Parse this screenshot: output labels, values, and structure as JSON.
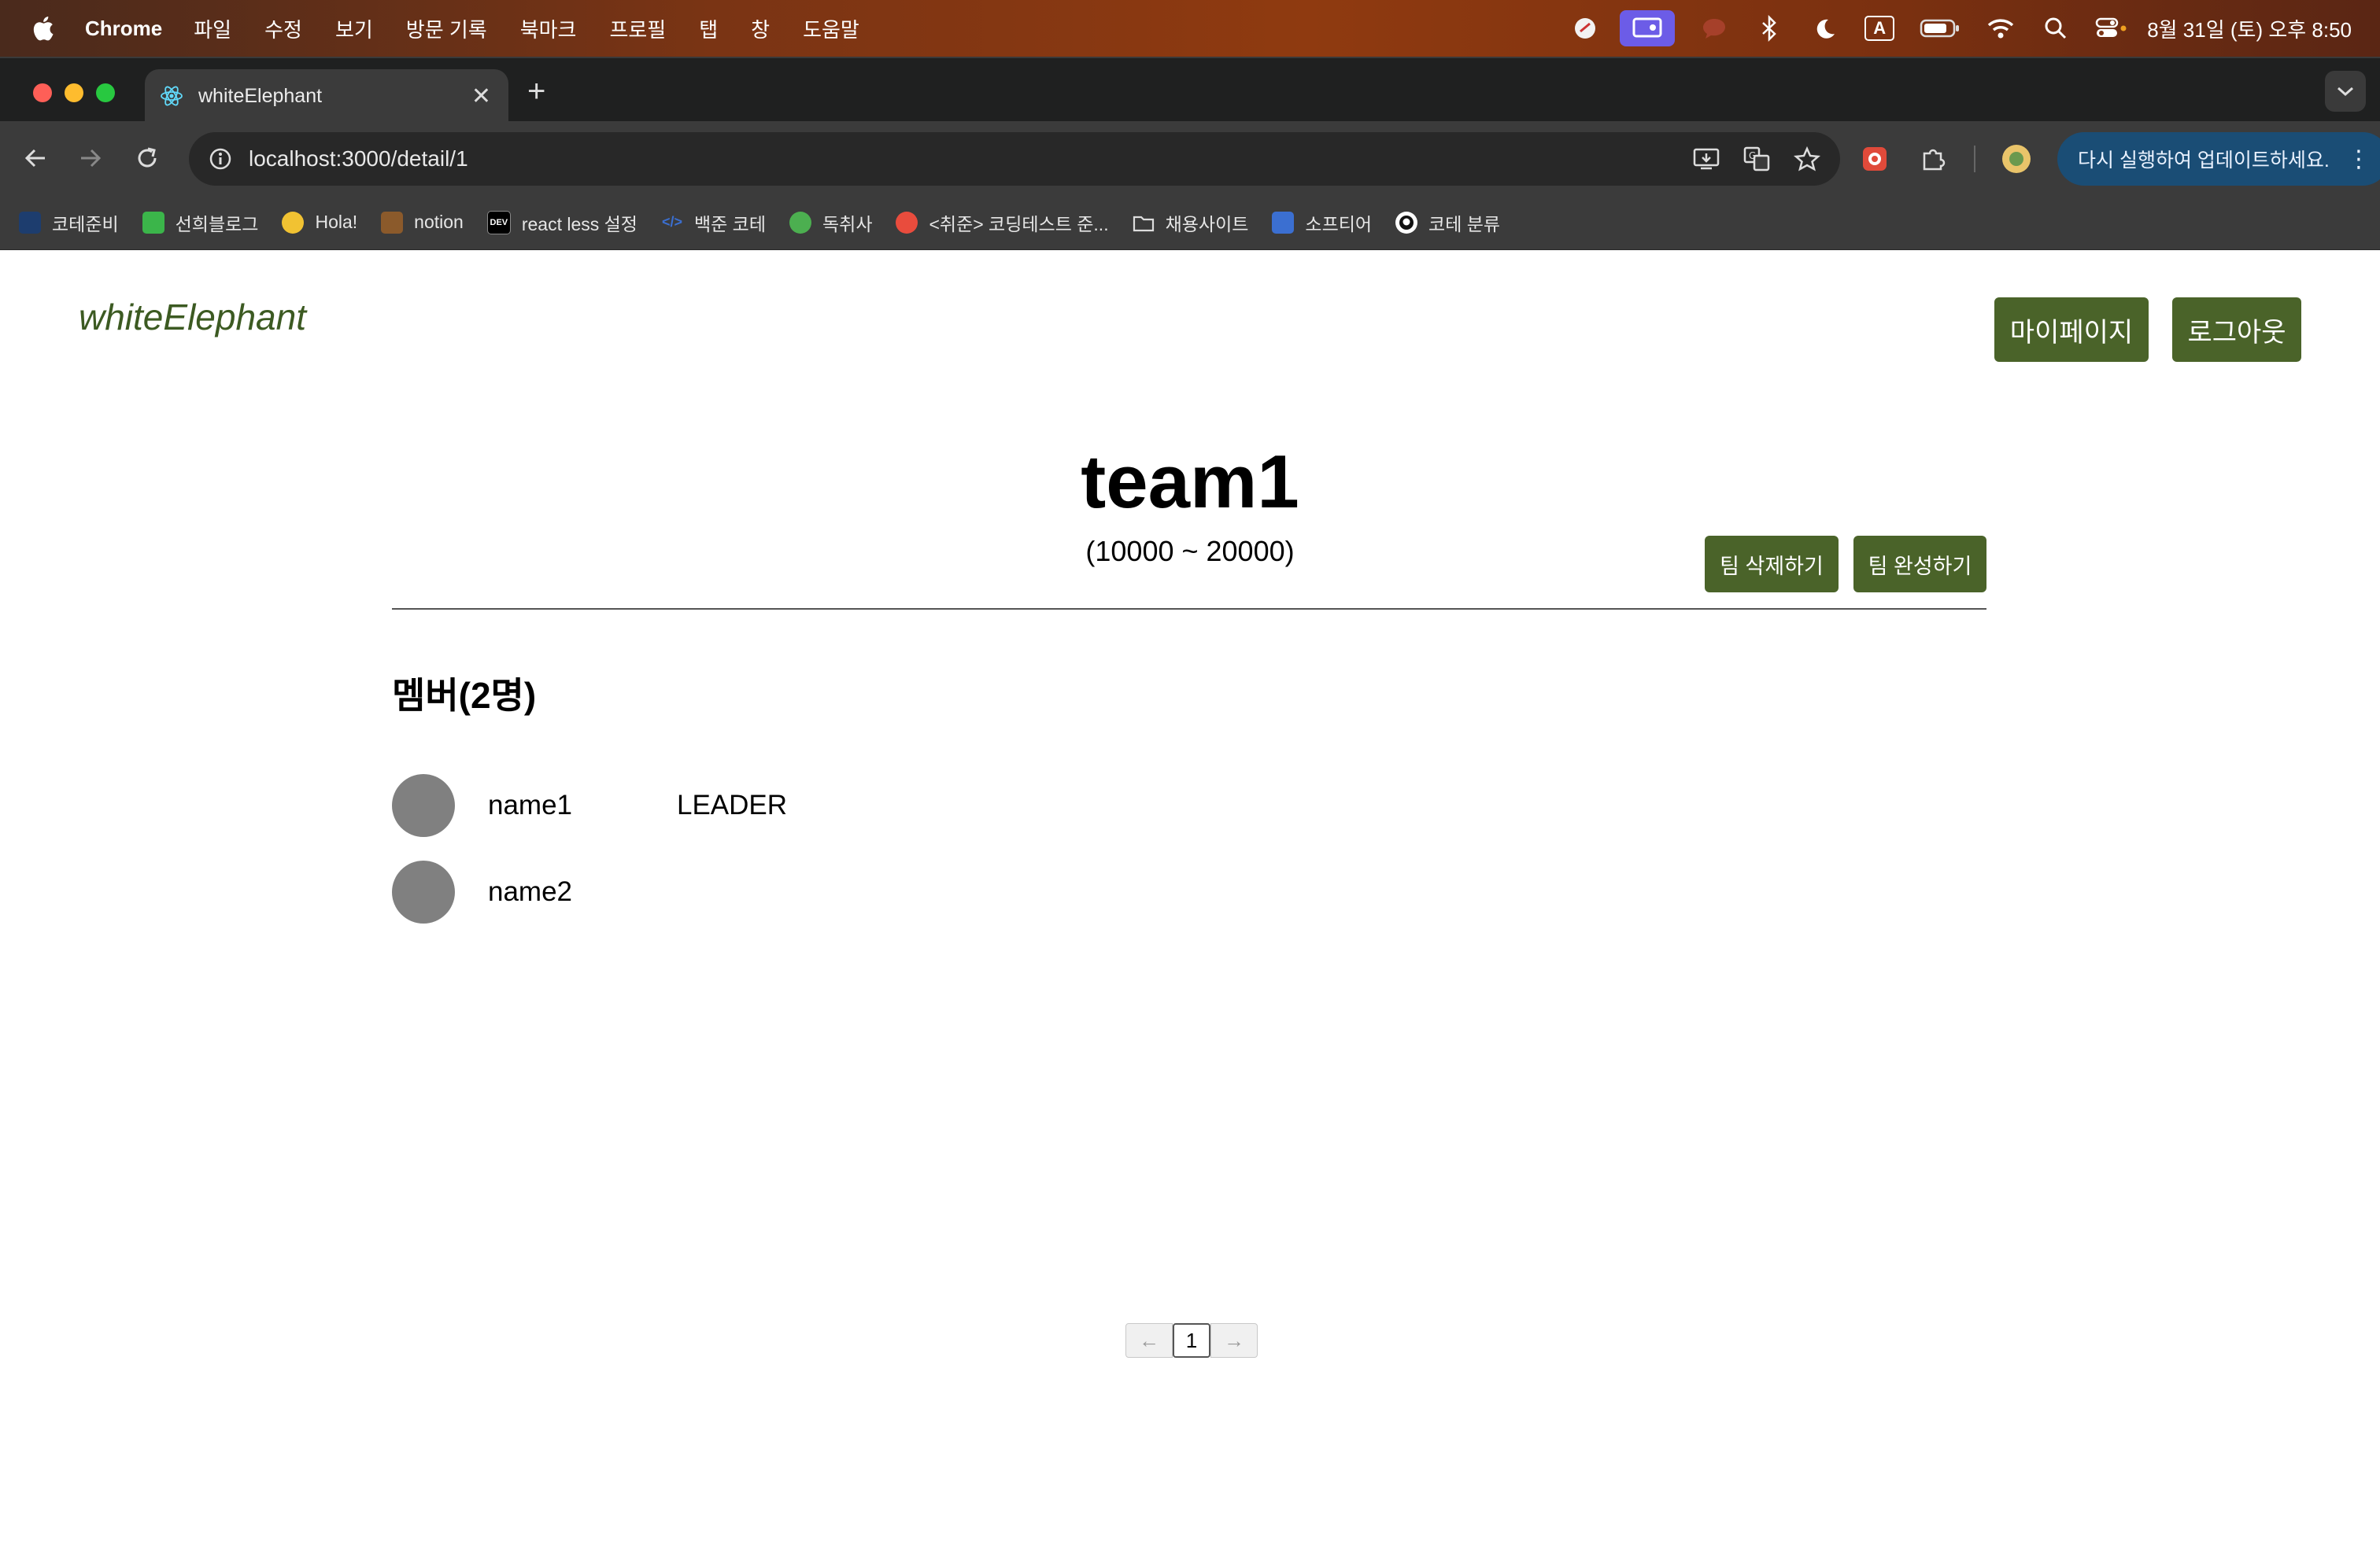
{
  "menubar": {
    "app": "Chrome",
    "items": [
      "파일",
      "수정",
      "보기",
      "방문 기록",
      "북마크",
      "프로필",
      "탭",
      "창",
      "도움말"
    ],
    "clock": "8월 31일 (토) 오후 8:50",
    "input_indicator": "A"
  },
  "browser": {
    "tab_title": "whiteElephant",
    "url": "localhost:3000/detail/1",
    "update_label": "다시 실행하여 업데이트하세요.",
    "bookmarks": [
      {
        "label": "코테준비",
        "icon": "bird-icon",
        "color": "#1d3d6e"
      },
      {
        "label": "선희블로그",
        "icon": "blog-icon",
        "color": "#3bb54a"
      },
      {
        "label": "Hola!",
        "icon": "hola-icon",
        "color": "#f1c232"
      },
      {
        "label": "notion",
        "icon": "books-icon",
        "color": "#8b5a2b"
      },
      {
        "label": "react less 설정",
        "icon": "dev-icon",
        "color": "#000000"
      },
      {
        "label": "백준 코테",
        "icon": "code-icon",
        "color": "#3b6fd1"
      },
      {
        "label": "독취사",
        "icon": "leaf-icon",
        "color": "#4caf50"
      },
      {
        "label": "<취준> 코딩테스트 준...",
        "icon": "tistory-icon",
        "color": "#e94c3d"
      },
      {
        "label": "채용사이트",
        "icon": "folder-icon",
        "color": "#3b3b3b"
      },
      {
        "label": "소프티어",
        "icon": "softeer-icon",
        "color": "#3b6fd1"
      },
      {
        "label": "코테 분류",
        "icon": "github-icon",
        "color": "#ffffff"
      }
    ]
  },
  "page": {
    "brand": "whiteElephant",
    "mypage_label": "마이페이지",
    "logout_label": "로그아웃",
    "team_name": "team1",
    "team_range": "(10000 ~ 20000)",
    "delete_label": "팀 삭제하기",
    "complete_label": "팀 완성하기",
    "members_title": "멤버(2명)",
    "members": [
      {
        "name": "name1",
        "role": "LEADER"
      },
      {
        "name": "name2",
        "role": ""
      }
    ],
    "pagination": {
      "prev": "←",
      "current": "1",
      "next": "→"
    },
    "accent_color": "#4a6329"
  }
}
